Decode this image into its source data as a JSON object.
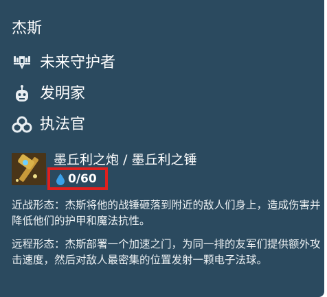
{
  "champion": {
    "name": "杰斯"
  },
  "traits": [
    {
      "label": "未来守护者",
      "icon": "future-guardian-icon"
    },
    {
      "label": "发明家",
      "icon": "inventor-icon"
    },
    {
      "label": "执法官",
      "icon": "enforcer-icon"
    }
  ],
  "ability": {
    "icon": "hammer-cannon-icon",
    "name": "墨丘利之炮 / 墨丘利之锤",
    "mana": "0/60",
    "mana_icon": "mana-drop-icon",
    "highlight_color": "#e0201e",
    "descriptions": [
      "近战形态：杰斯将他的战锤砸落到附近的敌人们身上，造成伤害并降低他们的护甲和魔法抗性。",
      "远程形态：杰斯部署一个加速之门，为同一排的友军们提供额外攻击速度，然后对敌人最密集的位置发射一颗电子法球。"
    ]
  },
  "colors": {
    "panel_background": "#2b4a5f",
    "text": "#ffffff",
    "mana_drop": "#3aa0e8"
  }
}
